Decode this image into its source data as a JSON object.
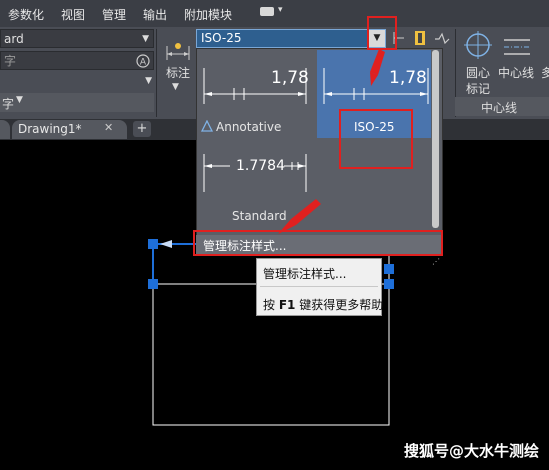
{
  "menubar": {
    "items": [
      "参数化",
      "视图",
      "管理",
      "输出",
      "附加模块"
    ]
  },
  "ribbon": {
    "text_style_combo": "ard",
    "search_placeholder": "字",
    "multileader_combo": "字",
    "dimension_button_label": "标注",
    "center_mark_label_1": "圆心",
    "center_mark_label_2": "标记",
    "centerline_label": "中心线",
    "centerline_panel_title": "中心线",
    "overflow_label": "多"
  },
  "tabs": {
    "drawing": "Drawing1*",
    "close_glyph": "✕",
    "add_glyph": "+"
  },
  "dimstyle": {
    "current": "ISO-25",
    "options": [
      {
        "name": "Annotative",
        "preview_value": "1,78"
      },
      {
        "name": "ISO-25",
        "preview_value": "1,78"
      },
      {
        "name": "Standard",
        "preview_value": "1.7784"
      }
    ],
    "manage_label": "管理标注样式..."
  },
  "context_menu": {
    "item1": "管理标注样式...",
    "item2_key": "F1",
    "item2_prefix": "按 ",
    "item2_suffix": " 键获得更多帮助"
  },
  "watermark": "搜狐号@大水牛测绘",
  "colors": {
    "highlight": "#4a74ad",
    "annotation_red": "#e0201f",
    "selection_blue": "#1e6fd9"
  }
}
